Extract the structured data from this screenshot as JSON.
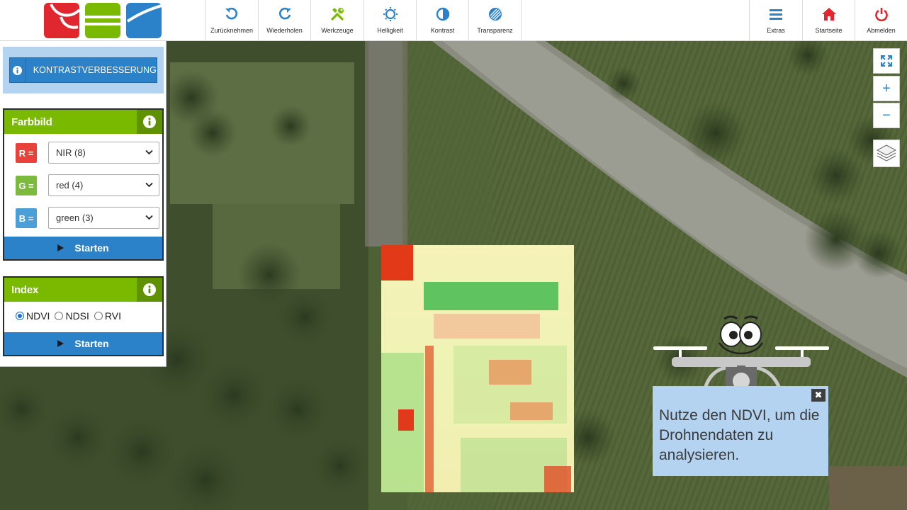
{
  "toolbar": {
    "undo_label": "Zurücknehmen",
    "redo_label": "Wiederholen",
    "tools_label": "Werkzeuge",
    "brightness_label": "Helligkeit",
    "contrast_label": "Kontrast",
    "transparency_label": "Transparenz",
    "extras_label": "Extras",
    "home_label": "Startseite",
    "logout_label": "Abmelden"
  },
  "colors": {
    "accent_blue": "#2c82c9",
    "accent_green": "#79b900",
    "light_blue": "#b3d3f0",
    "logout_red": "#e0262e",
    "band_red": "#e8423a",
    "band_green": "#7cba3e",
    "band_blue": "#4a9fd8"
  },
  "panel": {
    "enhance_button_label": "KONTRASTVERBESSERUNG",
    "farbbild": {
      "title": "Farbbild",
      "bands": [
        {
          "tag": "R =",
          "selected": "NIR (8)"
        },
        {
          "tag": "G =",
          "selected": "red (4)"
        },
        {
          "tag": "B =",
          "selected": "green (3)"
        }
      ],
      "start_label": "Starten"
    },
    "index": {
      "title": "Index",
      "options": [
        "NDVI",
        "NDSI",
        "RVI"
      ],
      "selected": "NDVI",
      "start_label": "Starten"
    }
  },
  "map_controls": {
    "zoom_in": "+",
    "zoom_out": "−"
  },
  "helper": {
    "message": "Nutze den NDVI, um die Drohnendaten zu analysieren.",
    "close": "✖"
  }
}
